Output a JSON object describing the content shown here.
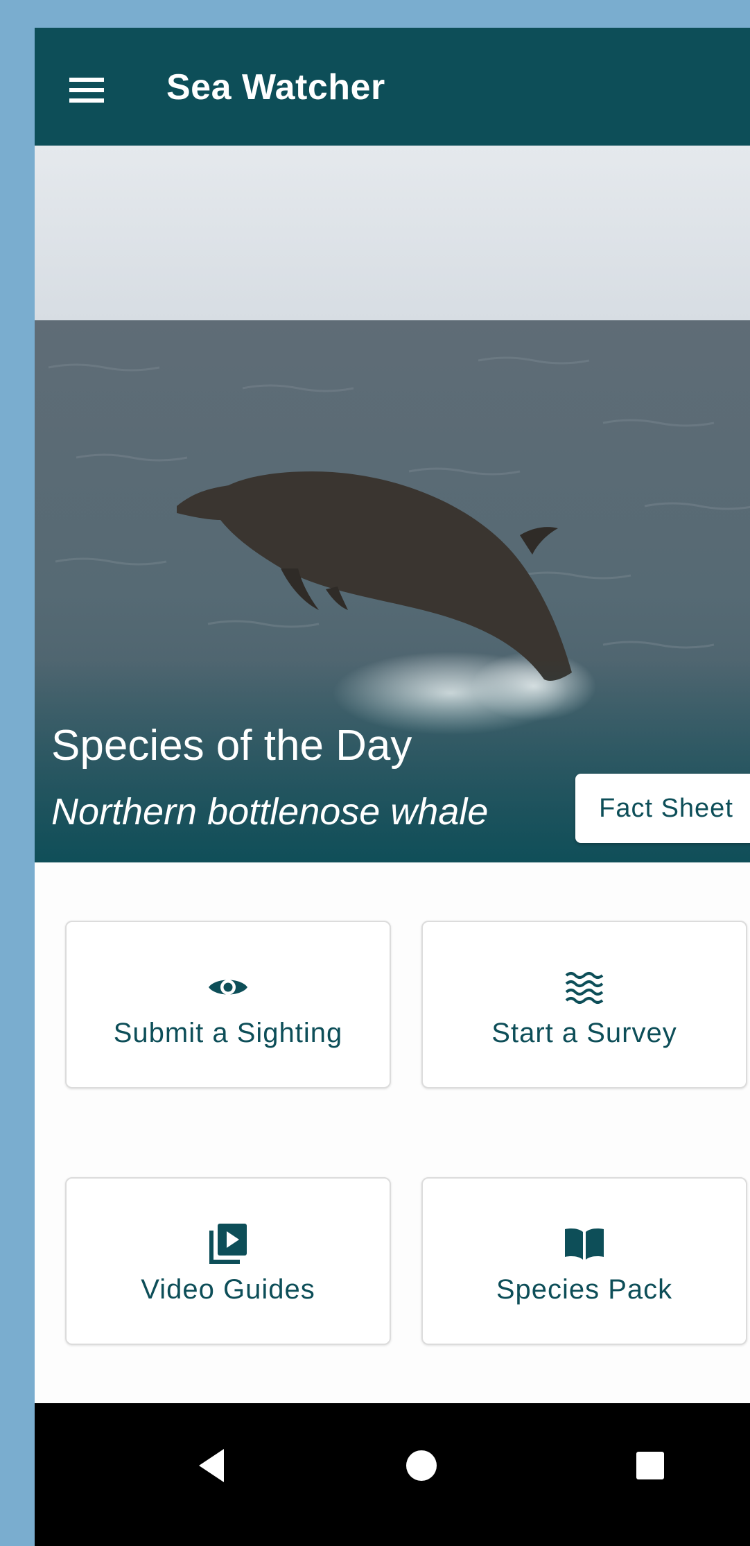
{
  "app_bar": {
    "title": "Sea Watcher",
    "menu_icon": "hamburger-menu-icon",
    "background_color": "#0d4e58"
  },
  "hero": {
    "heading": "Species of the Day",
    "species_name": "Northern bottlenose whale",
    "fact_sheet_label": "Fact Sheet"
  },
  "tiles": [
    {
      "label": "Submit a Sighting",
      "icon": "eye-icon"
    },
    {
      "label": "Start a Survey",
      "icon": "waves-icon"
    },
    {
      "label": "Video Guides",
      "icon": "video-library-icon"
    },
    {
      "label": "Species Pack",
      "icon": "book-icon"
    }
  ],
  "navigation": {
    "back_icon": "back-triangle-icon",
    "home_icon": "home-circle-icon",
    "recents_icon": "recents-square-icon"
  },
  "colors": {
    "accent": "#0d4e58",
    "outer_background": "#7aadcf"
  }
}
